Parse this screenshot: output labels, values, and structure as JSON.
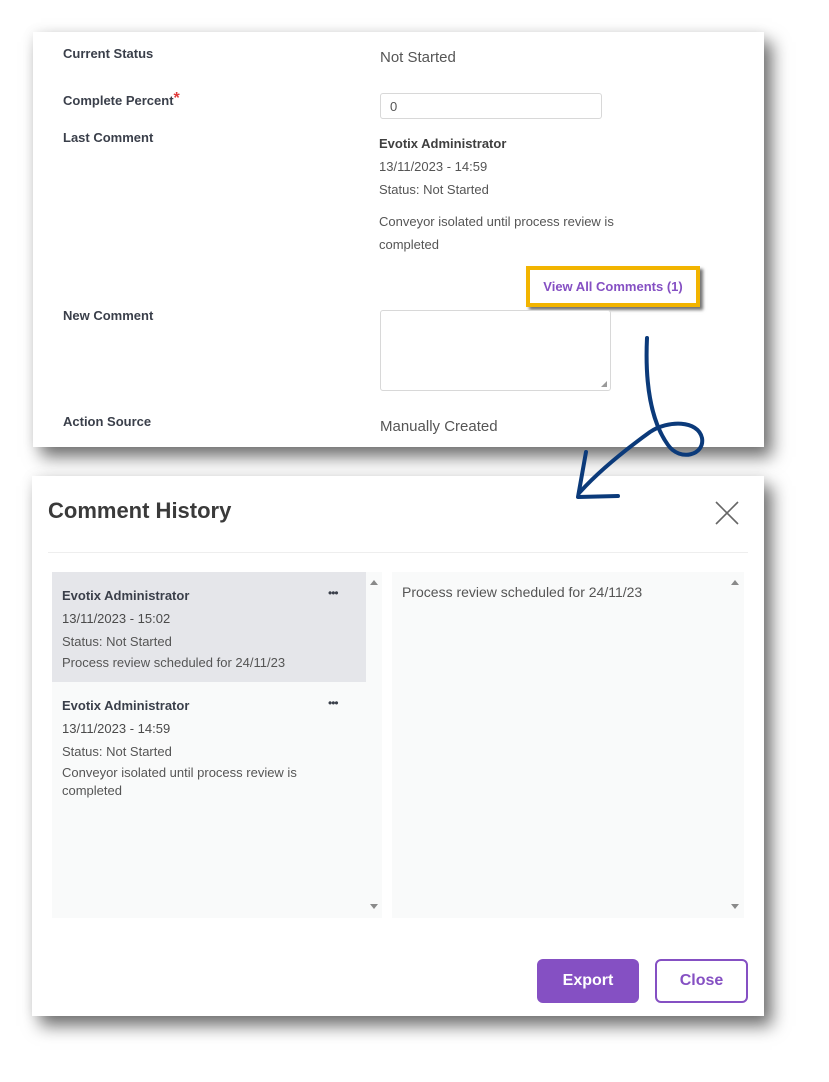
{
  "form": {
    "current_status_label": "Current Status",
    "current_status_value": "Not Started",
    "complete_percent_label": "Complete Percent",
    "required_marker": "*",
    "complete_percent_value": "0",
    "last_comment_label": "Last Comment",
    "last_comment": {
      "author": "Evotix Administrator",
      "timestamp": "13/11/2023 - 14:59",
      "status": "Status: Not Started",
      "text_line1": "Conveyor isolated until process review is",
      "text_line2": "completed"
    },
    "view_all_comments_label": "View All Comments (1)",
    "new_comment_label": "New Comment",
    "new_comment_value": "",
    "action_source_label": "Action Source",
    "action_source_value": "Manually Created"
  },
  "modal": {
    "title": "Comment History",
    "comments": [
      {
        "author": "Evotix Administrator",
        "timestamp": "13/11/2023 - 15:02",
        "status": "Status: Not Started",
        "text": "Process review scheduled for 24/11/23",
        "selected": true,
        "menu_icon": "•••"
      },
      {
        "author": "Evotix Administrator",
        "timestamp": "13/11/2023 - 14:59",
        "status": "Status: Not Started",
        "text": "Conveyor isolated until process review is completed",
        "selected": false,
        "menu_icon": "•••"
      }
    ],
    "detail_text": "Process review scheduled for 24/11/23",
    "export_label": "Export",
    "close_label": "Close"
  },
  "colors": {
    "accent": "#8550c3",
    "highlight": "#f2b400",
    "annotation_arrow": "#0b3a7a",
    "required": "#e03a3a"
  }
}
